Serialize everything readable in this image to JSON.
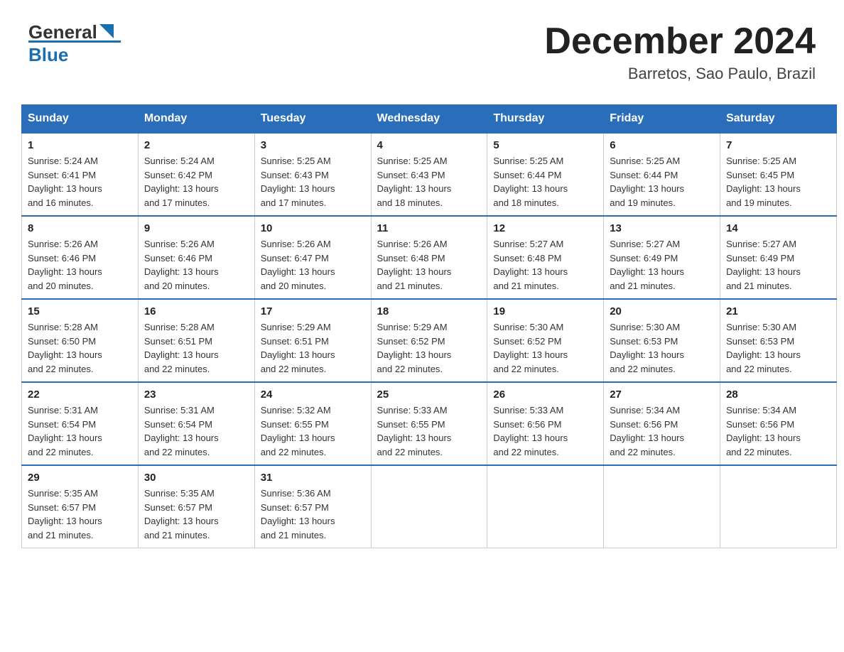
{
  "header": {
    "logo": {
      "general": "General",
      "blue": "Blue"
    },
    "title": "December 2024",
    "location": "Barretos, Sao Paulo, Brazil"
  },
  "calendar": {
    "headers": [
      "Sunday",
      "Monday",
      "Tuesday",
      "Wednesday",
      "Thursday",
      "Friday",
      "Saturday"
    ],
    "weeks": [
      [
        {
          "day": "1",
          "sunrise": "5:24 AM",
          "sunset": "6:41 PM",
          "daylight": "13 hours and 16 minutes."
        },
        {
          "day": "2",
          "sunrise": "5:24 AM",
          "sunset": "6:42 PM",
          "daylight": "13 hours and 17 minutes."
        },
        {
          "day": "3",
          "sunrise": "5:25 AM",
          "sunset": "6:43 PM",
          "daylight": "13 hours and 17 minutes."
        },
        {
          "day": "4",
          "sunrise": "5:25 AM",
          "sunset": "6:43 PM",
          "daylight": "13 hours and 18 minutes."
        },
        {
          "day": "5",
          "sunrise": "5:25 AM",
          "sunset": "6:44 PM",
          "daylight": "13 hours and 18 minutes."
        },
        {
          "day": "6",
          "sunrise": "5:25 AM",
          "sunset": "6:44 PM",
          "daylight": "13 hours and 19 minutes."
        },
        {
          "day": "7",
          "sunrise": "5:25 AM",
          "sunset": "6:45 PM",
          "daylight": "13 hours and 19 minutes."
        }
      ],
      [
        {
          "day": "8",
          "sunrise": "5:26 AM",
          "sunset": "6:46 PM",
          "daylight": "13 hours and 20 minutes."
        },
        {
          "day": "9",
          "sunrise": "5:26 AM",
          "sunset": "6:46 PM",
          "daylight": "13 hours and 20 minutes."
        },
        {
          "day": "10",
          "sunrise": "5:26 AM",
          "sunset": "6:47 PM",
          "daylight": "13 hours and 20 minutes."
        },
        {
          "day": "11",
          "sunrise": "5:26 AM",
          "sunset": "6:48 PM",
          "daylight": "13 hours and 21 minutes."
        },
        {
          "day": "12",
          "sunrise": "5:27 AM",
          "sunset": "6:48 PM",
          "daylight": "13 hours and 21 minutes."
        },
        {
          "day": "13",
          "sunrise": "5:27 AM",
          "sunset": "6:49 PM",
          "daylight": "13 hours and 21 minutes."
        },
        {
          "day": "14",
          "sunrise": "5:27 AM",
          "sunset": "6:49 PM",
          "daylight": "13 hours and 21 minutes."
        }
      ],
      [
        {
          "day": "15",
          "sunrise": "5:28 AM",
          "sunset": "6:50 PM",
          "daylight": "13 hours and 22 minutes."
        },
        {
          "day": "16",
          "sunrise": "5:28 AM",
          "sunset": "6:51 PM",
          "daylight": "13 hours and 22 minutes."
        },
        {
          "day": "17",
          "sunrise": "5:29 AM",
          "sunset": "6:51 PM",
          "daylight": "13 hours and 22 minutes."
        },
        {
          "day": "18",
          "sunrise": "5:29 AM",
          "sunset": "6:52 PM",
          "daylight": "13 hours and 22 minutes."
        },
        {
          "day": "19",
          "sunrise": "5:30 AM",
          "sunset": "6:52 PM",
          "daylight": "13 hours and 22 minutes."
        },
        {
          "day": "20",
          "sunrise": "5:30 AM",
          "sunset": "6:53 PM",
          "daylight": "13 hours and 22 minutes."
        },
        {
          "day": "21",
          "sunrise": "5:30 AM",
          "sunset": "6:53 PM",
          "daylight": "13 hours and 22 minutes."
        }
      ],
      [
        {
          "day": "22",
          "sunrise": "5:31 AM",
          "sunset": "6:54 PM",
          "daylight": "13 hours and 22 minutes."
        },
        {
          "day": "23",
          "sunrise": "5:31 AM",
          "sunset": "6:54 PM",
          "daylight": "13 hours and 22 minutes."
        },
        {
          "day": "24",
          "sunrise": "5:32 AM",
          "sunset": "6:55 PM",
          "daylight": "13 hours and 22 minutes."
        },
        {
          "day": "25",
          "sunrise": "5:33 AM",
          "sunset": "6:55 PM",
          "daylight": "13 hours and 22 minutes."
        },
        {
          "day": "26",
          "sunrise": "5:33 AM",
          "sunset": "6:56 PM",
          "daylight": "13 hours and 22 minutes."
        },
        {
          "day": "27",
          "sunrise": "5:34 AM",
          "sunset": "6:56 PM",
          "daylight": "13 hours and 22 minutes."
        },
        {
          "day": "28",
          "sunrise": "5:34 AM",
          "sunset": "6:56 PM",
          "daylight": "13 hours and 22 minutes."
        }
      ],
      [
        {
          "day": "29",
          "sunrise": "5:35 AM",
          "sunset": "6:57 PM",
          "daylight": "13 hours and 21 minutes."
        },
        {
          "day": "30",
          "sunrise": "5:35 AM",
          "sunset": "6:57 PM",
          "daylight": "13 hours and 21 minutes."
        },
        {
          "day": "31",
          "sunrise": "5:36 AM",
          "sunset": "6:57 PM",
          "daylight": "13 hours and 21 minutes."
        },
        null,
        null,
        null,
        null
      ]
    ]
  }
}
